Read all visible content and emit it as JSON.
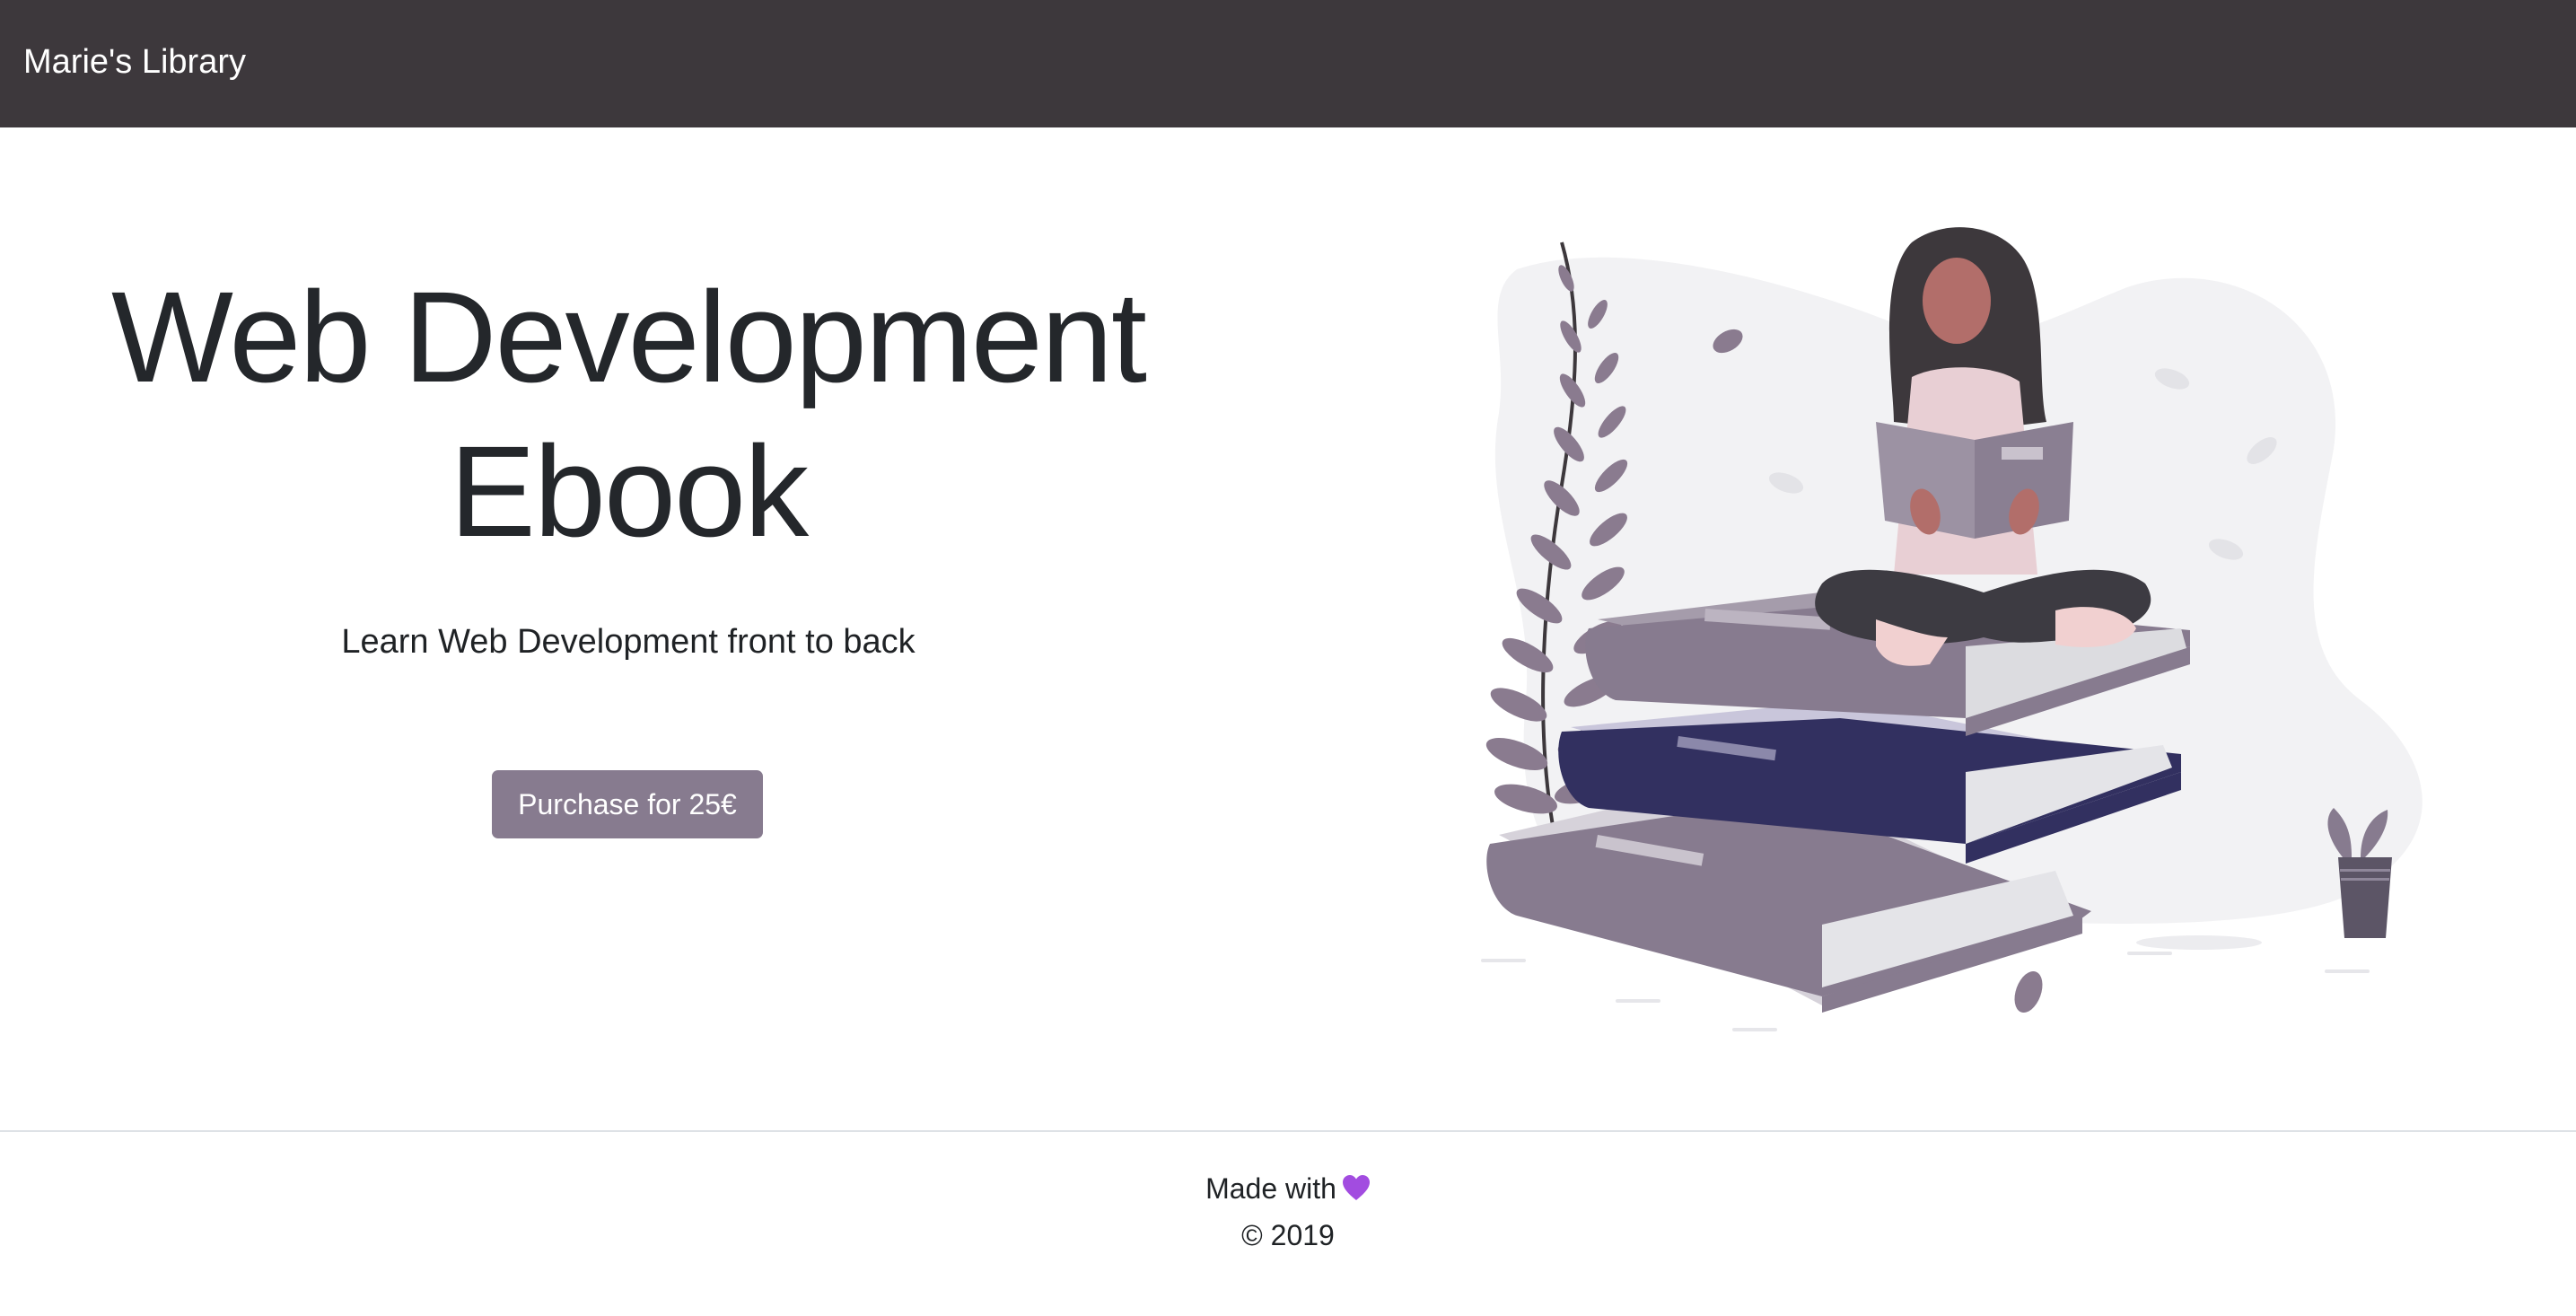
{
  "navbar": {
    "brand": "Marie's Library",
    "background": "#3d383c"
  },
  "hero": {
    "title": "Web Development Ebook",
    "subtitle": "Learn Web Development front to back",
    "purchase_button": "Purchase for 25€",
    "button_color": "#877b8f",
    "illustration": "woman-reading-on-books-illustration"
  },
  "footer": {
    "made_with": "Made with",
    "heart_icon": "purple-heart-icon",
    "copyright": "© 2019"
  }
}
